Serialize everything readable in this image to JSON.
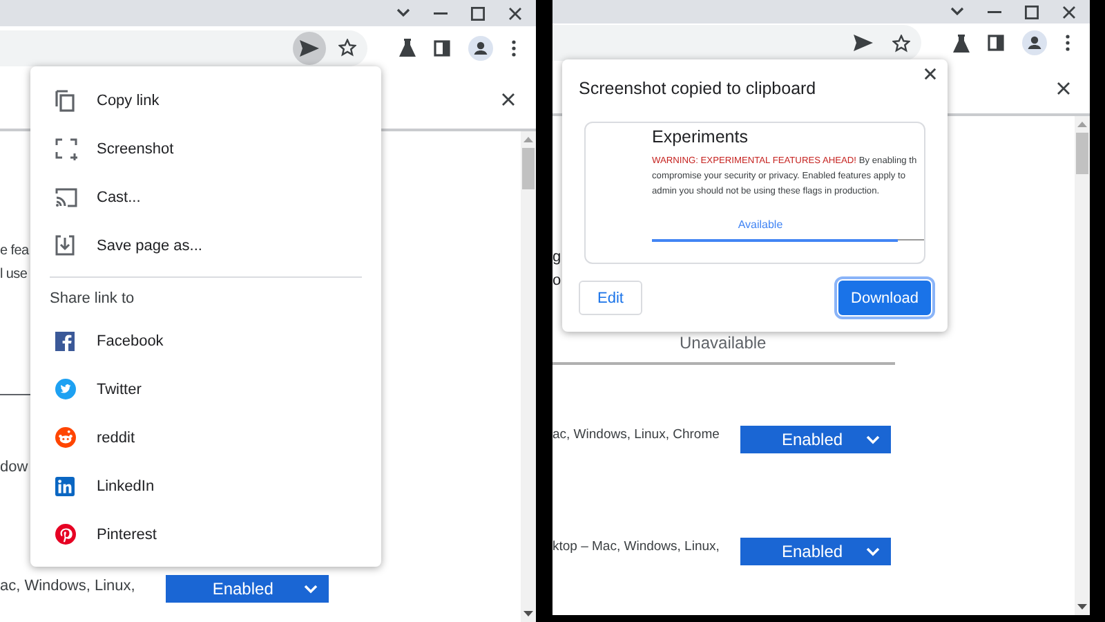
{
  "left": {
    "page": {
      "fragments": [
        "e fea",
        "l use"
      ],
      "fragment_2": "dow",
      "flag": {
        "text": "ac, Windows, Linux,",
        "value": "Enabled"
      }
    },
    "share_menu": {
      "items": [
        {
          "label": "Copy link"
        },
        {
          "label": "Screenshot"
        },
        {
          "label": "Cast..."
        },
        {
          "label": "Save page as..."
        }
      ],
      "section_title": "Share link to",
      "share_targets": [
        {
          "label": "Facebook"
        },
        {
          "label": "Twitter"
        },
        {
          "label": "reddit"
        },
        {
          "label": "LinkedIn"
        },
        {
          "label": "Pinterest"
        }
      ]
    }
  },
  "right": {
    "page": {
      "fragments": [
        "g",
        "o"
      ],
      "tab_label": "Unavailable",
      "flags": [
        {
          "text": "ac, Windows, Linux, Chrome",
          "value": "Enabled"
        },
        {
          "text": "ktop – Mac, Windows, Linux,",
          "value": "Enabled"
        }
      ]
    },
    "dialog": {
      "title": "Screenshot copied to clipboard",
      "preview": {
        "heading": "Experiments",
        "warning": "WARNING: EXPERIMENTAL FEATURES AHEAD!",
        "lines": [
          "By enabling th",
          "compromise your security or privacy. Enabled features apply to",
          "admin you should not be using these flags in production."
        ],
        "tab_label": "Available"
      },
      "buttons": [
        {
          "label": "Edit",
          "kind": "secondary"
        },
        {
          "label": "Download",
          "kind": "primary"
        }
      ]
    }
  }
}
